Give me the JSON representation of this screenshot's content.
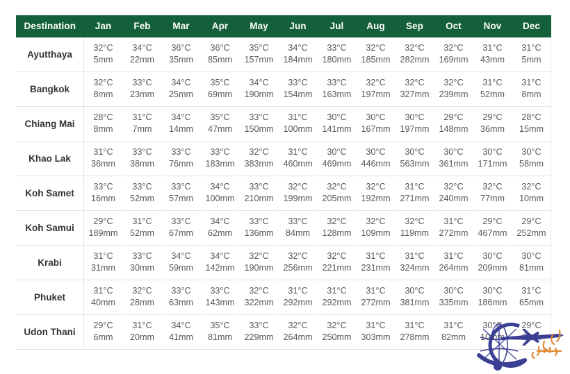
{
  "table": {
    "header": {
      "destination_label": "Destination",
      "months": [
        "Jan",
        "Feb",
        "Mar",
        "Apr",
        "May",
        "Jun",
        "Jul",
        "Aug",
        "Sep",
        "Oct",
        "Nov",
        "Dec"
      ]
    },
    "colors": {
      "header_bg": "#14603a",
      "header_text": "#ffffff",
      "destination_text": "#333333",
      "value_text": "#585858",
      "row_divider": "#e4e4e4",
      "watermark_blue": "#3b3f93",
      "watermark_orange": "#e08a33"
    },
    "rows": [
      {
        "destination": "Ayutthaya",
        "temps": [
          "32°C",
          "34°C",
          "36°C",
          "36°C",
          "35°C",
          "34°C",
          "33°C",
          "32°C",
          "32°C",
          "32°C",
          "31°C",
          "31°C"
        ],
        "rain": [
          "5mm",
          "22mm",
          "35mm",
          "85mm",
          "157mm",
          "184mm",
          "180mm",
          "185mm",
          "282mm",
          "169mm",
          "43mm",
          "5mm"
        ]
      },
      {
        "destination": "Bangkok",
        "temps": [
          "32°C",
          "33°C",
          "34°C",
          "35°C",
          "34°C",
          "33°C",
          "33°C",
          "32°C",
          "32°C",
          "32°C",
          "31°C",
          "31°C"
        ],
        "rain": [
          "8mm",
          "23mm",
          "25mm",
          "69mm",
          "190mm",
          "154mm",
          "163mm",
          "197mm",
          "327mm",
          "239mm",
          "52mm",
          "8mm"
        ]
      },
      {
        "destination": "Chiang Mai",
        "temps": [
          "28°C",
          "31°C",
          "34°C",
          "35°C",
          "33°C",
          "31°C",
          "30°C",
          "30°C",
          "30°C",
          "29°C",
          "29°C",
          "28°C"
        ],
        "rain": [
          "8mm",
          "7mm",
          "14mm",
          "47mm",
          "150mm",
          "100mm",
          "141mm",
          "167mm",
          "197mm",
          "148mm",
          "36mm",
          "15mm"
        ]
      },
      {
        "destination": "Khao Lak",
        "temps": [
          "31°C",
          "33°C",
          "33°C",
          "33°C",
          "32°C",
          "31°C",
          "30°C",
          "30°C",
          "30°C",
          "30°C",
          "30°C",
          "30°C"
        ],
        "rain": [
          "36mm",
          "38mm",
          "76mm",
          "183mm",
          "383mm",
          "460mm",
          "469mm",
          "446mm",
          "563mm",
          "361mm",
          "171mm",
          "58mm"
        ]
      },
      {
        "destination": "Koh Samet",
        "temps": [
          "33°C",
          "33°C",
          "33°C",
          "34°C",
          "33°C",
          "32°C",
          "32°C",
          "32°C",
          "31°C",
          "32°C",
          "32°C",
          "32°C"
        ],
        "rain": [
          "16mm",
          "52mm",
          "57mm",
          "100mm",
          "210mm",
          "199mm",
          "205mm",
          "192mm",
          "271mm",
          "240mm",
          "77mm",
          "10mm"
        ]
      },
      {
        "destination": "Koh Samui",
        "temps": [
          "29°C",
          "31°C",
          "33°C",
          "34°C",
          "33°C",
          "33°C",
          "32°C",
          "32°C",
          "32°C",
          "31°C",
          "29°C",
          "29°C"
        ],
        "rain": [
          "189mm",
          "52mm",
          "67mm",
          "62mm",
          "136mm",
          "84mm",
          "128mm",
          "109mm",
          "119mm",
          "272mm",
          "467mm",
          "252mm"
        ]
      },
      {
        "destination": "Krabi",
        "temps": [
          "31°C",
          "33°C",
          "34°C",
          "34°C",
          "32°C",
          "32°C",
          "32°C",
          "31°C",
          "31°C",
          "31°C",
          "30°C",
          "30°C"
        ],
        "rain": [
          "31mm",
          "30mm",
          "59mm",
          "142mm",
          "190mm",
          "256mm",
          "221mm",
          "231mm",
          "324mm",
          "264mm",
          "209mm",
          "81mm"
        ]
      },
      {
        "destination": "Phuket",
        "temps": [
          "31°C",
          "32°C",
          "33°C",
          "33°C",
          "32°C",
          "31°C",
          "31°C",
          "31°C",
          "30°C",
          "30°C",
          "30°C",
          "31°C"
        ],
        "rain": [
          "40mm",
          "28mm",
          "63mm",
          "143mm",
          "322mm",
          "292mm",
          "292mm",
          "272mm",
          "381mm",
          "335mm",
          "186mm",
          "65mm"
        ]
      },
      {
        "destination": "Udon Thani",
        "temps": [
          "29°C",
          "31°C",
          "34°C",
          "35°C",
          "33°C",
          "32°C",
          "32°C",
          "31°C",
          "31°C",
          "31°C",
          "30°C",
          "29°C"
        ],
        "rain": [
          "6mm",
          "20mm",
          "41mm",
          "81mm",
          "229mm",
          "264mm",
          "250mm",
          "303mm",
          "278mm",
          "82mm",
          "10mm",
          "3mm"
        ]
      }
    ]
  },
  "watermark": {
    "icon": "globe-airplane-logo",
    "script_text": "سلیمانی"
  }
}
